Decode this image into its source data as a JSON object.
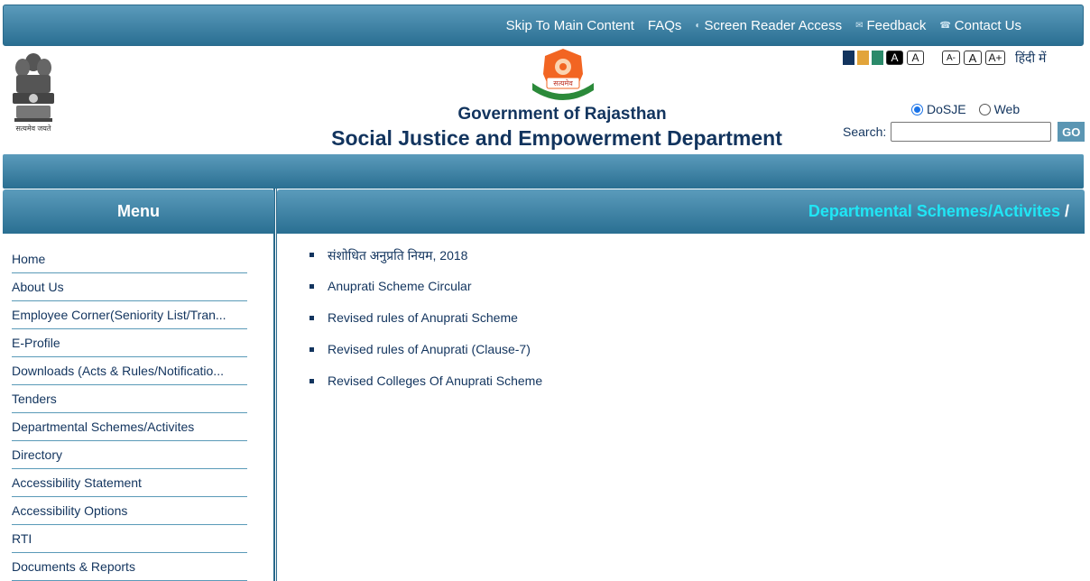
{
  "topbar": {
    "links": [
      {
        "label": "Skip To Main Content",
        "icon": ""
      },
      {
        "label": "FAQs",
        "icon": ""
      },
      {
        "label": "Screen Reader Access",
        "icon": "screen-reader-icon"
      },
      {
        "label": "Feedback",
        "icon": "mail-icon"
      },
      {
        "label": "Contact Us",
        "icon": "phone-icon"
      }
    ]
  },
  "header": {
    "emblem_caption": "सत्यमेव जयते",
    "seal_text": "सत्यमेव",
    "title_line1": "Government of Rajasthan",
    "title_line2": "Social Justice and Empowerment Department",
    "hindi_link": "हिंदी में",
    "contrast": {
      "swatch_colors": [
        "#12345e",
        "#e2a43a",
        "#2b8a6a"
      ],
      "black_a": "A",
      "white_a": "A"
    },
    "font_size": {
      "decrease": "A-",
      "normal": "A",
      "increase": "A+"
    },
    "search": {
      "option_dosje": "DoSJE",
      "option_web": "Web",
      "selected": "DoSJE",
      "label": "Search:",
      "value": "",
      "go_label": "GO"
    }
  },
  "sidebar": {
    "title": "Menu",
    "items": [
      "Home",
      "About Us",
      "Employee Corner(Seniority List/Tran...",
      "E-Profile",
      "Downloads (Acts & Rules/Notificatio...",
      "Tenders",
      "Departmental Schemes/Activites",
      "Directory",
      "Accessibility Statement",
      "Accessibility Options",
      "RTI",
      "Documents & Reports"
    ]
  },
  "content": {
    "breadcrumb": "Departmental Schemes/Activites",
    "breadcrumb_sep": "/",
    "items": [
      "संशोधित अनुप्रति नियम, 2018",
      "Anuprati Scheme Circular",
      "Revised rules of Anuprati Scheme",
      "Revised rules of Anuprati (Clause-7)",
      "Revised Colleges Of Anuprati Scheme"
    ]
  },
  "colors": {
    "accent": "#2a6f92",
    "title": "#12345e",
    "breadcrumb": "#20e6f5"
  }
}
